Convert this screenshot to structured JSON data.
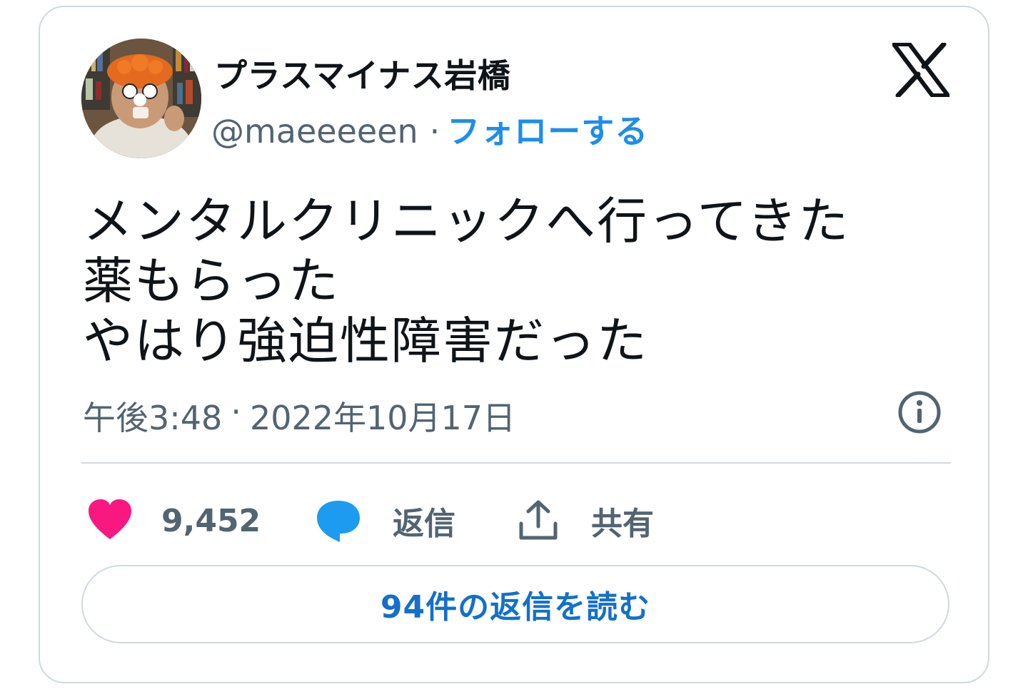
{
  "user": {
    "display_name": "プラスマイナス岩橋",
    "handle": "@maeeeeen",
    "separator": "·",
    "follow_label": "フォローする"
  },
  "tweet": {
    "lines": [
      "メンタルクリニックへ行ってきた",
      "薬もらった",
      "やはり強迫性障害だった"
    ],
    "time": "午後3:48",
    "separator": "·",
    "date": "2022年10月17日"
  },
  "actions": {
    "like_count": "9,452",
    "reply_label": "返信",
    "share_label": "共有"
  },
  "read_replies_label": "94件の返信を読む",
  "icons": {
    "platform": "x-logo-icon",
    "info": "info-icon",
    "like": "heart-icon",
    "reply": "speech-bubble-icon",
    "share": "share-upload-icon"
  },
  "colors": {
    "like": "#f91880",
    "reply": "#1d9bf0",
    "follow_link": "#1d8eeb",
    "read_replies": "#1470c9",
    "secondary_text": "#536471",
    "border": "#cfd9de"
  }
}
